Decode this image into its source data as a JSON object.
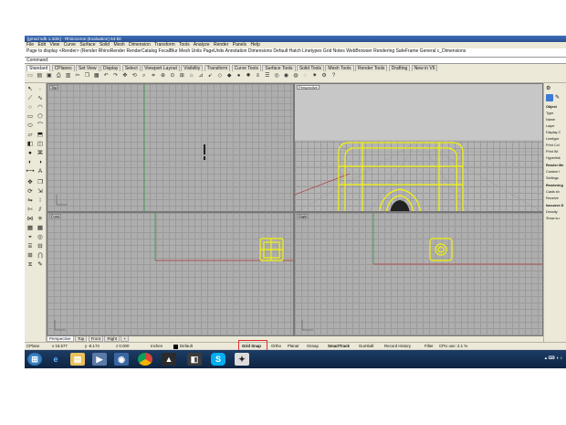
{
  "window": {
    "title": "[gmod sdb 1.3dm] - Rhinoceros (Evaluation) 64-bit"
  },
  "menu": [
    "File",
    "Edit",
    "View",
    "Curve",
    "Surface",
    "Solid",
    "Mesh",
    "Dimension",
    "Transform",
    "Tools",
    "Analyze",
    "Render",
    "Panels",
    "Help"
  ],
  "command_history": "Page to display <Render> (Render RhinoRender RenderCatalog FocalBlur Mesh Units PageUnits Annotation Dimensions Default Hatch Linetypes Grid Notes WebBrowser Rendering SafeFrame General c_Dimensions",
  "command_prompt": "Command:",
  "toolbar_tabs": [
    "Standard",
    "CPlanes",
    "Set View",
    "Display",
    "Select",
    "Viewport Layout",
    "Visibility",
    "Transform",
    "Curve Tools",
    "Surface Tools",
    "Solid Tools",
    "Mesh Tools",
    "Render Tools",
    "Drafting",
    "New in V6"
  ],
  "viewports": {
    "top": "Top",
    "perspective": "Perspective",
    "front": "Front",
    "right": "Right"
  },
  "viewport_tabs": [
    "Perspective",
    "Top",
    "Front",
    "Right",
    "+"
  ],
  "properties_panel": {
    "object_header": "Object",
    "fields": [
      "Type",
      "Name",
      "Layer",
      "Display C",
      "Linetype",
      "Print Col",
      "Print Wi",
      "Hyperlink"
    ],
    "render_header": "Render Me",
    "render_fields": [
      "Custom I",
      "Settings"
    ],
    "rendering_header": "Rendering",
    "rendering_fields": [
      "Casts sh",
      "Receive"
    ],
    "isocurve_header": "Isocurve D",
    "isocurve_fields": [
      "Density",
      "Show su"
    ]
  },
  "status": {
    "cplane": "CPlane",
    "x": "x 16.577",
    "y": "y -8.174",
    "z": "z 0.000",
    "units": "Inches",
    "layer": "Default",
    "grid_snap": "Grid Snap",
    "ortho": "Ortho",
    "planar": "Planar",
    "osnap": "Osnap",
    "smarttrack": "SmartTrack",
    "gumball": "Gumball",
    "record_history": "Record History",
    "filter": "Filter",
    "cpu": "CPU use: 2.1 %"
  },
  "taskbar": [
    "start",
    "ie",
    "explorer",
    "media",
    "chrome",
    "rhino",
    "sketchup",
    "skype",
    "app"
  ],
  "colors": {
    "selection": "#f2f20a",
    "x_axis": "#b53333",
    "y_axis": "#2e9a45",
    "highlight": "#e23030"
  }
}
